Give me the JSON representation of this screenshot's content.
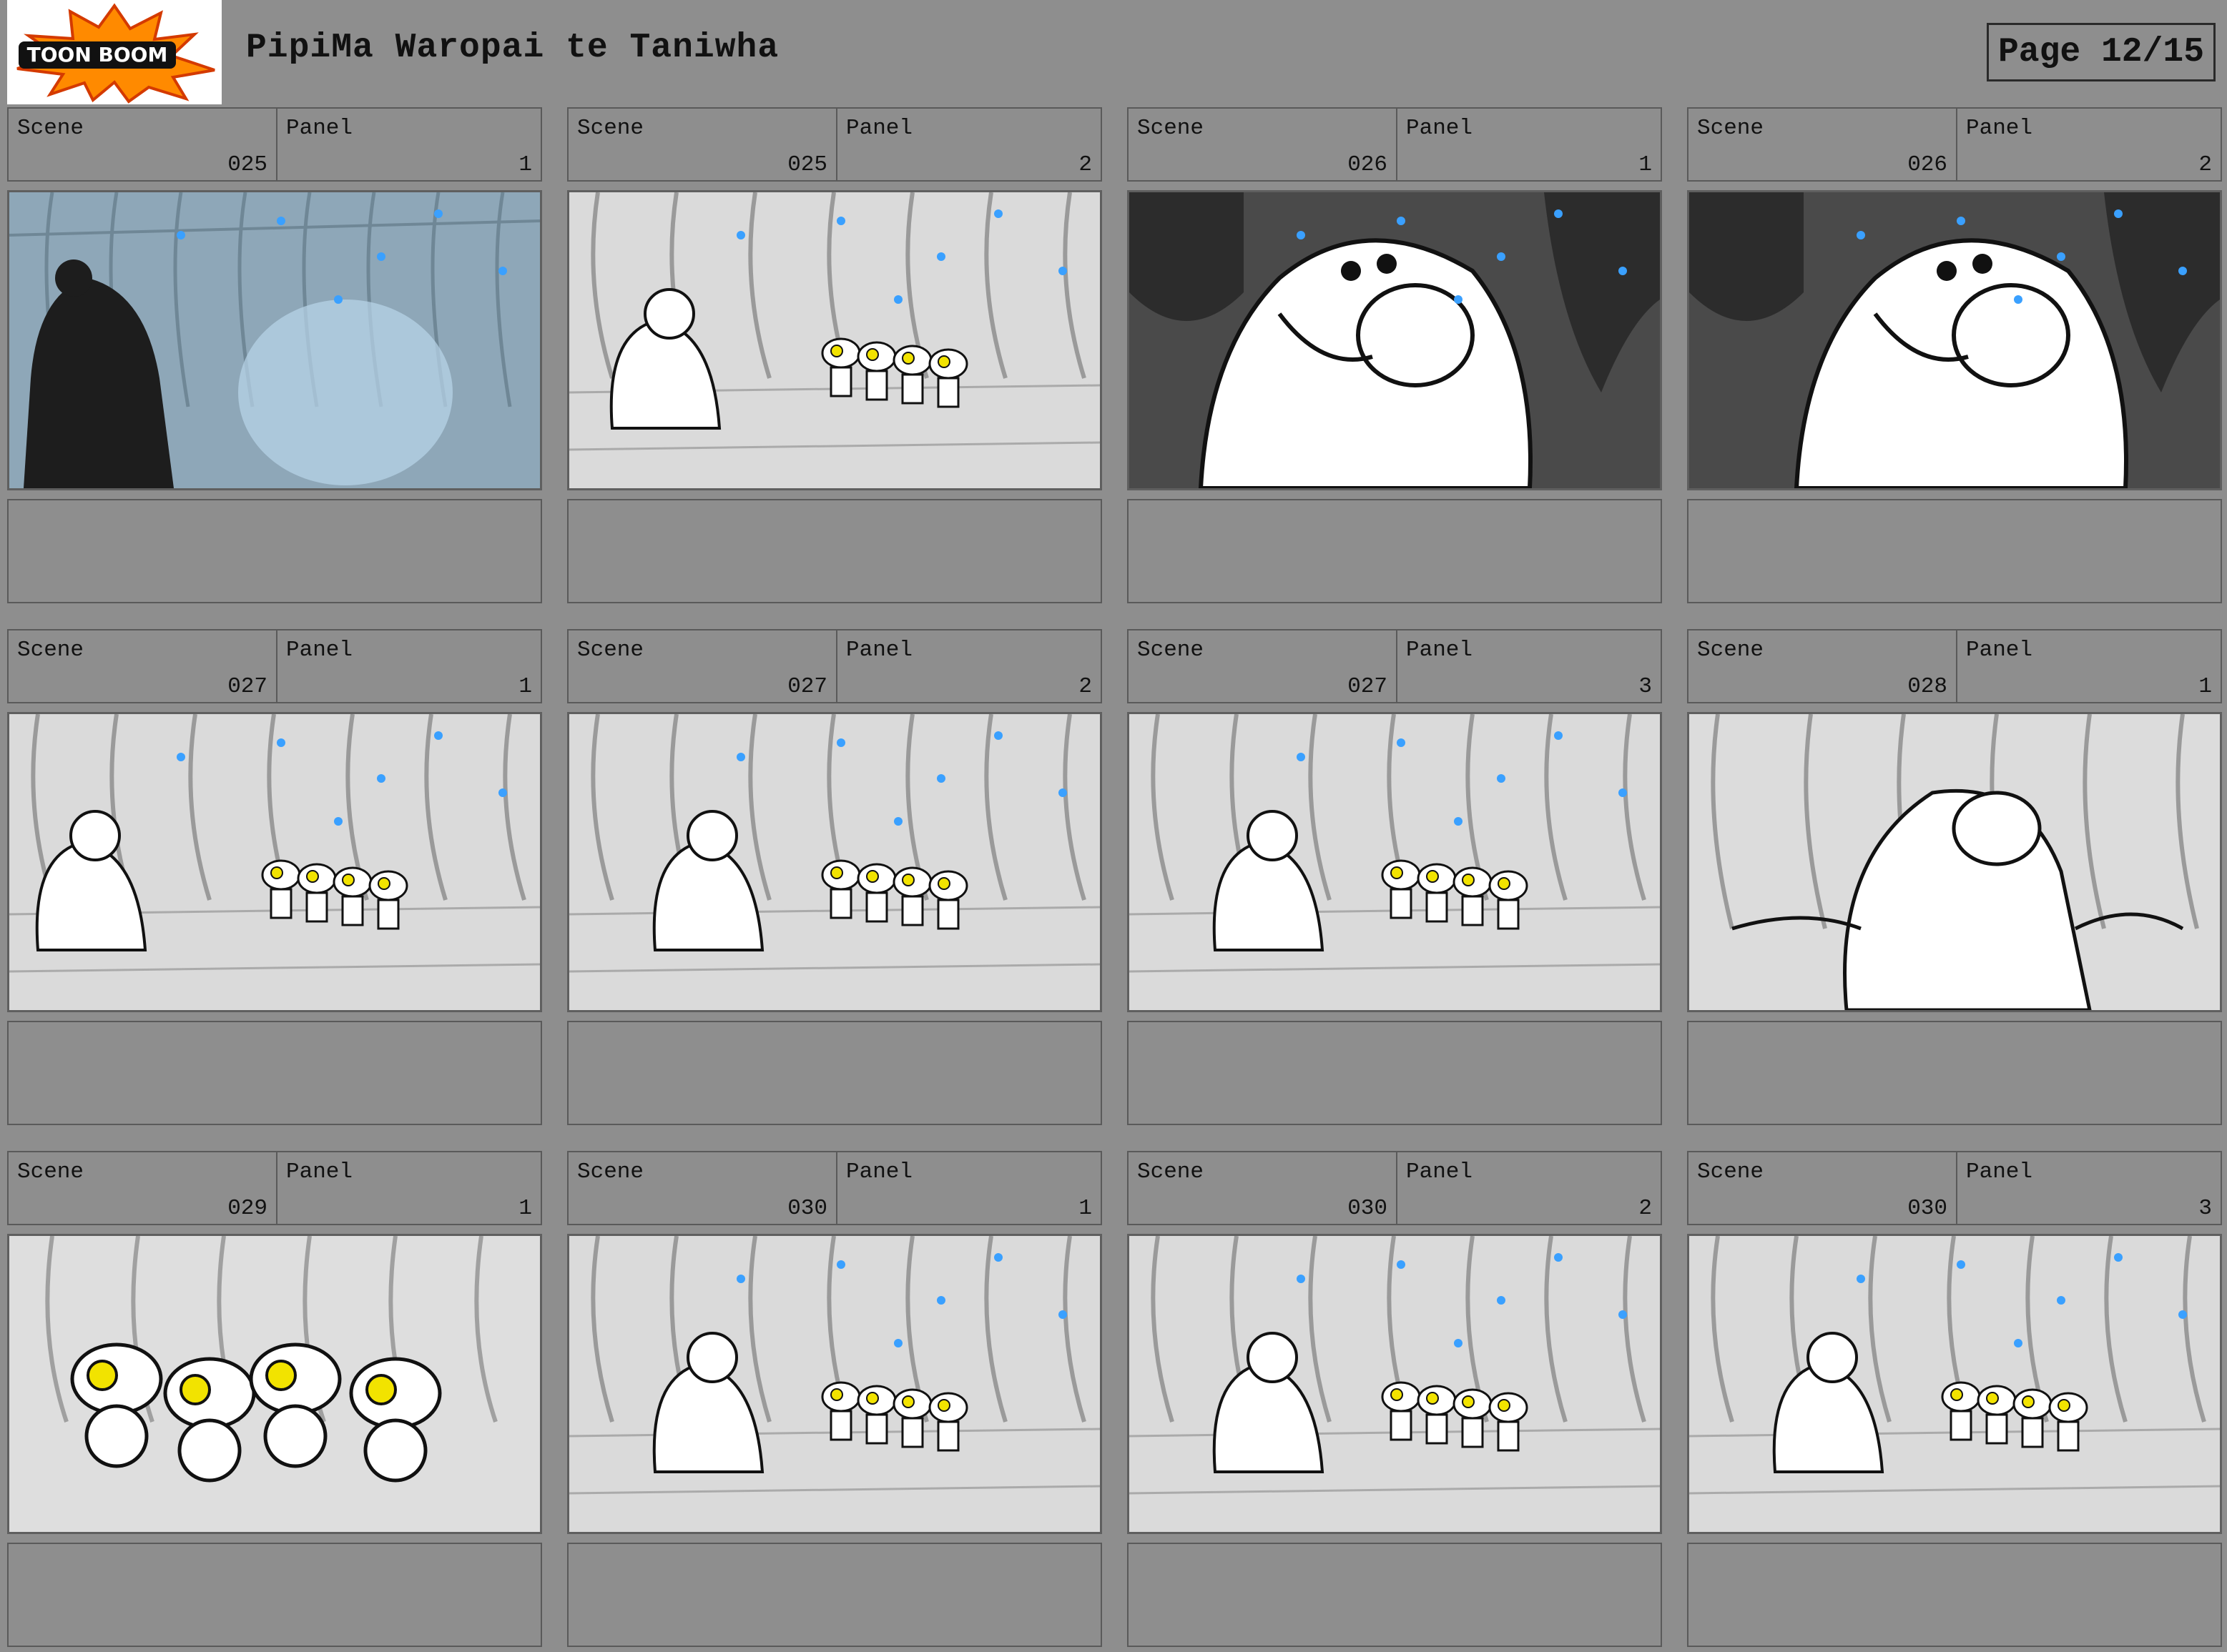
{
  "header": {
    "logo_text": "TOON BOOM",
    "title": "PipiMa Waropai te Taniwha",
    "page": "Page 12/15"
  },
  "labels": {
    "scene": "Scene",
    "panel": "Panel"
  },
  "panels": [
    {
      "scene": "025",
      "panel": "1",
      "style": "dark-cave"
    },
    {
      "scene": "025",
      "panel": "2",
      "style": "wide"
    },
    {
      "scene": "026",
      "panel": "1",
      "style": "closeup"
    },
    {
      "scene": "026",
      "panel": "2",
      "style": "closeup-tight"
    },
    {
      "scene": "027",
      "panel": "1",
      "style": "wide"
    },
    {
      "scene": "027",
      "panel": "2",
      "style": "wide"
    },
    {
      "scene": "027",
      "panel": "3",
      "style": "wide"
    },
    {
      "scene": "028",
      "panel": "1",
      "style": "medium"
    },
    {
      "scene": "029",
      "panel": "1",
      "style": "kids-closeup"
    },
    {
      "scene": "030",
      "panel": "1",
      "style": "wide"
    },
    {
      "scene": "030",
      "panel": "2",
      "style": "wide"
    },
    {
      "scene": "030",
      "panel": "3",
      "style": "wide"
    }
  ],
  "colors": {
    "page_bg": "#8e8e8e",
    "glow": "#3aa0ff",
    "lamp": "#f2e300",
    "cave_dark": "#4a4a4a",
    "cave_blue": "#8ea7b8"
  }
}
